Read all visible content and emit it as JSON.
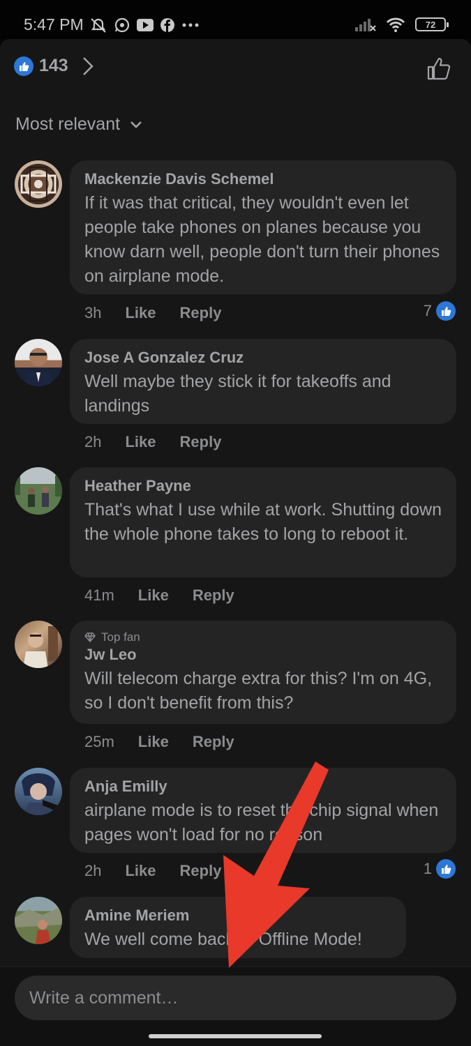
{
  "status_bar": {
    "time": "5:47 PM",
    "battery": "72",
    "left_icons": [
      "mute-alarm-icon",
      "whatsapp-icon",
      "youtube-icon",
      "facebook-icon",
      "more-dots-icon"
    ],
    "right_icons": [
      "signal-icon",
      "wifi-icon",
      "battery-icon"
    ]
  },
  "header": {
    "reaction_count": "143",
    "sort_label": "Most relevant"
  },
  "comments": [
    {
      "author": "Mackenzie Davis Schemel",
      "text": "If it was that critical, they wouldn't even let people take phones on planes because you know darn well, people don't turn their phones on airplane mode.",
      "time": "3h",
      "like": "Like",
      "reply": "Reply",
      "reactions": "7"
    },
    {
      "author": "Jose A Gonzalez Cruz",
      "text": "Well maybe they stick it for takeoffs and landings",
      "time": "2h",
      "like": "Like",
      "reply": "Reply"
    },
    {
      "author": "Heather Payne",
      "text": "That's what I use while at work. Shutting down the whole phone takes to long to reboot it.",
      "time": "41m",
      "like": "Like",
      "reply": "Reply"
    },
    {
      "badge": "Top fan",
      "author": "Jw Leo",
      "text": "Will telecom charge extra for this? I'm on 4G, so I don't benefit from this?",
      "time": "25m",
      "like": "Like",
      "reply": "Reply"
    },
    {
      "author": "Anja Emilly",
      "text": "airplane mode is to reset the chip signal when pages won't load for no reason",
      "time": "2h",
      "like": "Like",
      "reply": "Reply",
      "reactions": "1"
    },
    {
      "author": "Amine Meriem",
      "text": "We well come back to Offline Mode!"
    }
  ],
  "composer": {
    "placeholder": "Write a comment…"
  },
  "colors": {
    "like_blue": "#2d78d6",
    "annotation_arrow": "#e8392a"
  }
}
